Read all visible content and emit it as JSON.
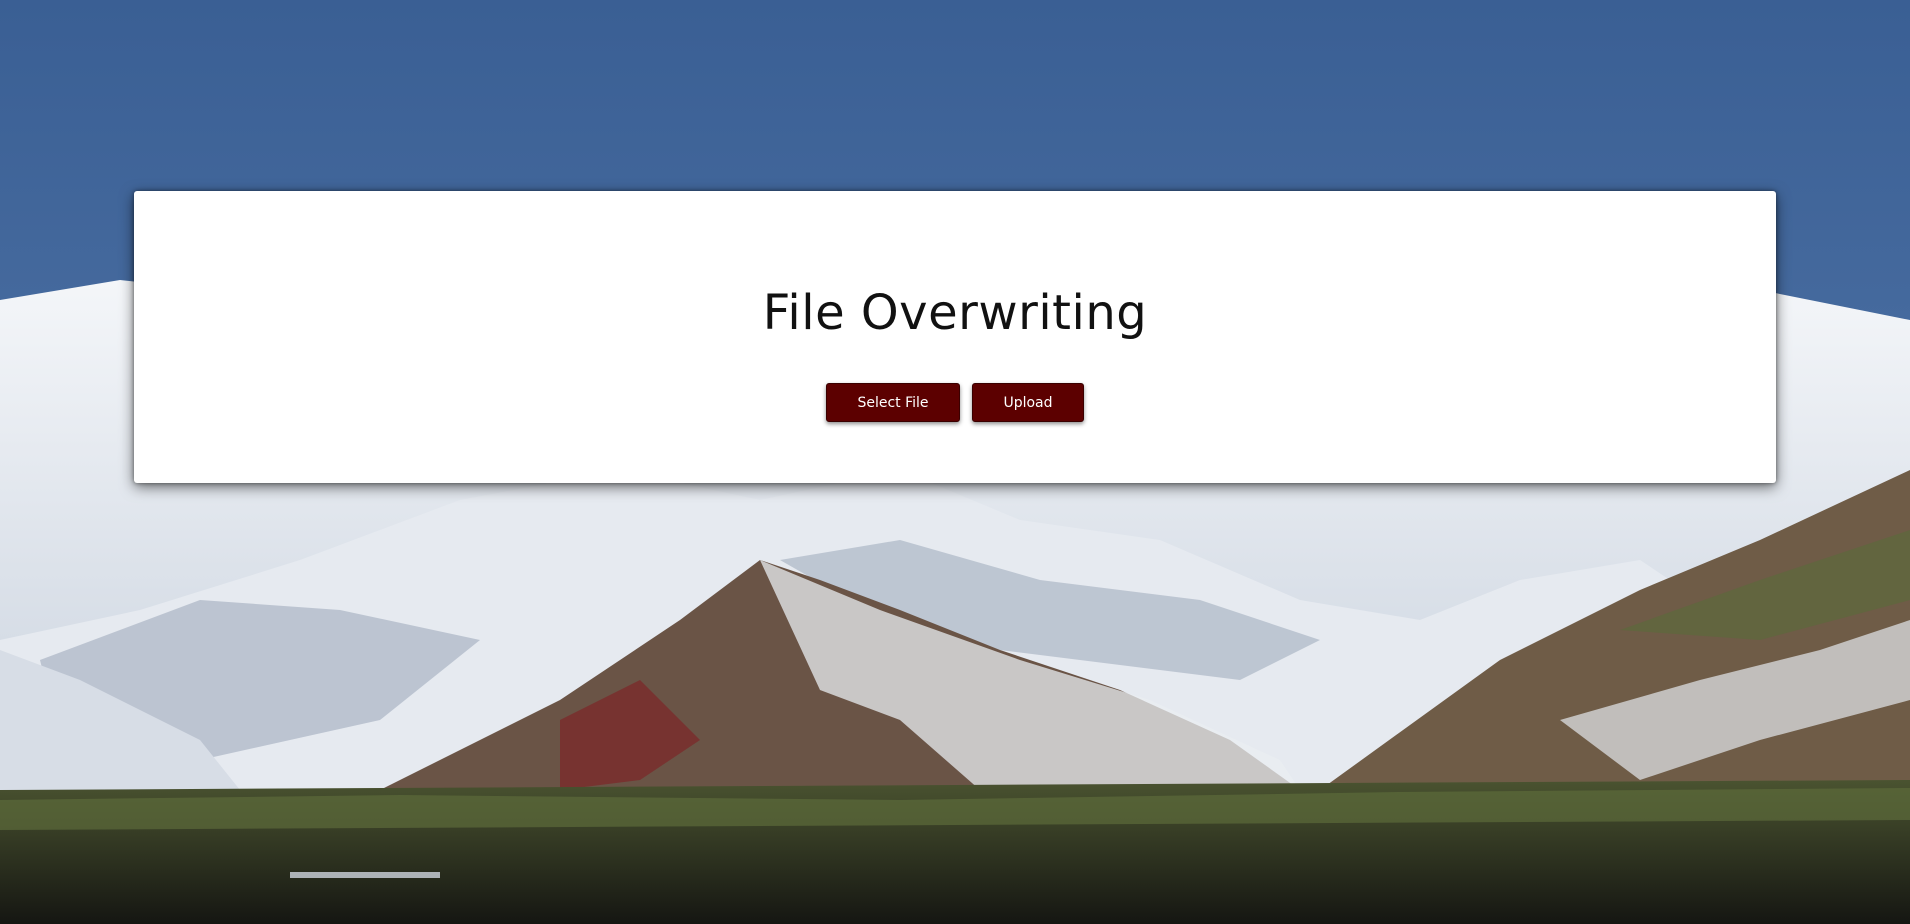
{
  "page": {
    "title": "File Overwriting"
  },
  "actions": {
    "select_file_label": "Select File",
    "upload_label": "Upload"
  },
  "colors": {
    "sky": "#3d6397",
    "button_bg": "#5c0000",
    "button_text": "#ffffff",
    "card_bg": "#ffffff"
  },
  "background": {
    "description_icon": "mountain-landscape-image"
  }
}
